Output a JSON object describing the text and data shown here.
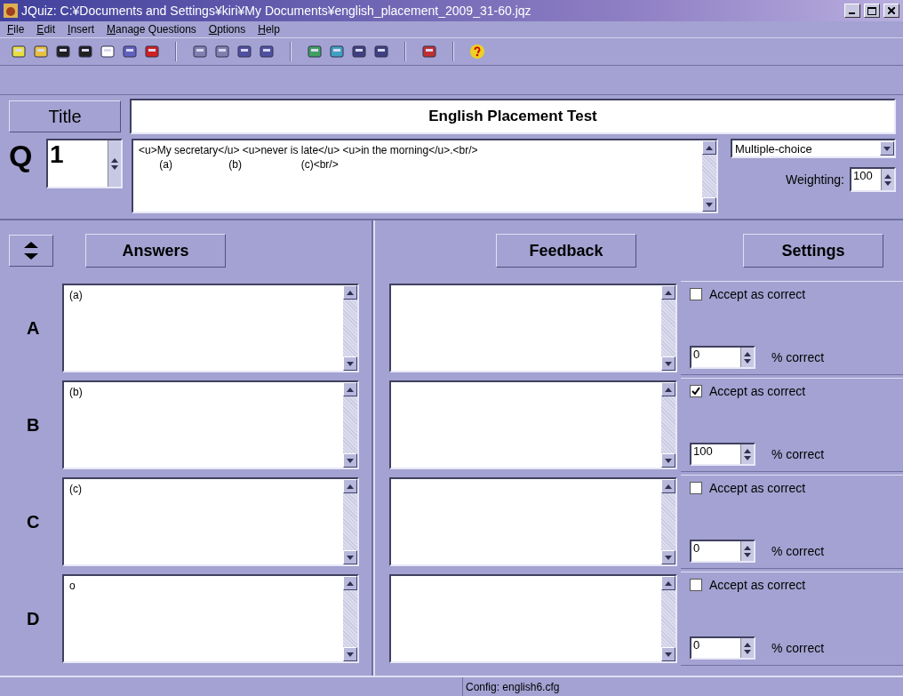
{
  "window": {
    "title": "JQuiz: C:¥Documents and Settings¥kiri¥My Documents¥english_placement_2009_31-60.jqz"
  },
  "menu": [
    {
      "label": "File"
    },
    {
      "label": "Edit"
    },
    {
      "label": "Insert"
    },
    {
      "label": "Manage Questions"
    },
    {
      "label": "Options"
    },
    {
      "label": "Help"
    }
  ],
  "title_label": "Title",
  "title_value": "English Placement Test",
  "question": {
    "label": "Q",
    "number": "1",
    "text": "<u>My secretary</u> <u>never is late</u> <u>in the morning</u>.<br/>\n       (a)                   (b)                    (c)<br/>",
    "type": "Multiple-choice",
    "weighting_label": "Weighting:",
    "weighting": "100"
  },
  "headers": {
    "answers": "Answers",
    "feedback": "Feedback",
    "settings": "Settings"
  },
  "answers": [
    {
      "letter": "A",
      "text": "(a)",
      "accept_label": "Accept as correct",
      "checked": false,
      "percent": "0",
      "percent_label": "% correct"
    },
    {
      "letter": "B",
      "text": "(b)",
      "accept_label": "Accept as correct",
      "checked": true,
      "percent": "100",
      "percent_label": "% correct"
    },
    {
      "letter": "C",
      "text": "(c)",
      "accept_label": "Accept as correct",
      "checked": false,
      "percent": "0",
      "percent_label": "% correct"
    },
    {
      "letter": "D",
      "text": "o",
      "accept_label": "Accept as correct",
      "checked": false,
      "percent": "0",
      "percent_label": "% correct"
    }
  ],
  "status_bar": "Config: english6.cfg"
}
